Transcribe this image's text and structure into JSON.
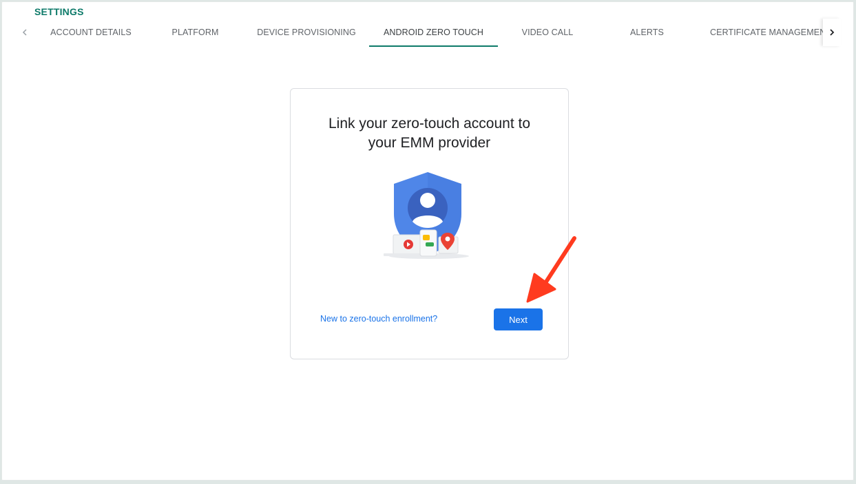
{
  "header": {
    "title": "SETTINGS"
  },
  "tabs": [
    {
      "label": "ACCOUNT DETAILS"
    },
    {
      "label": "PLATFORM"
    },
    {
      "label": "DEVICE PROVISIONING"
    },
    {
      "label": "ANDROID ZERO TOUCH",
      "active": true
    },
    {
      "label": "VIDEO CALL"
    },
    {
      "label": "ALERTS"
    },
    {
      "label": "CERTIFICATE MANAGEMENT"
    }
  ],
  "card": {
    "title_line1": "Link your zero-touch account to",
    "title_line2": "your EMM provider",
    "help_link": "New to zero-touch enrollment?",
    "next_label": "Next"
  },
  "colors": {
    "accent": "#0d7a69",
    "primary_button": "#1a73e8",
    "link": "#1a73e8",
    "annotation": "#ff3b1f"
  },
  "icons": {
    "tabs_prev": "chevron-left-icon",
    "tabs_next": "chevron-right-icon",
    "illustration": "shield-user-devices-illustration"
  }
}
